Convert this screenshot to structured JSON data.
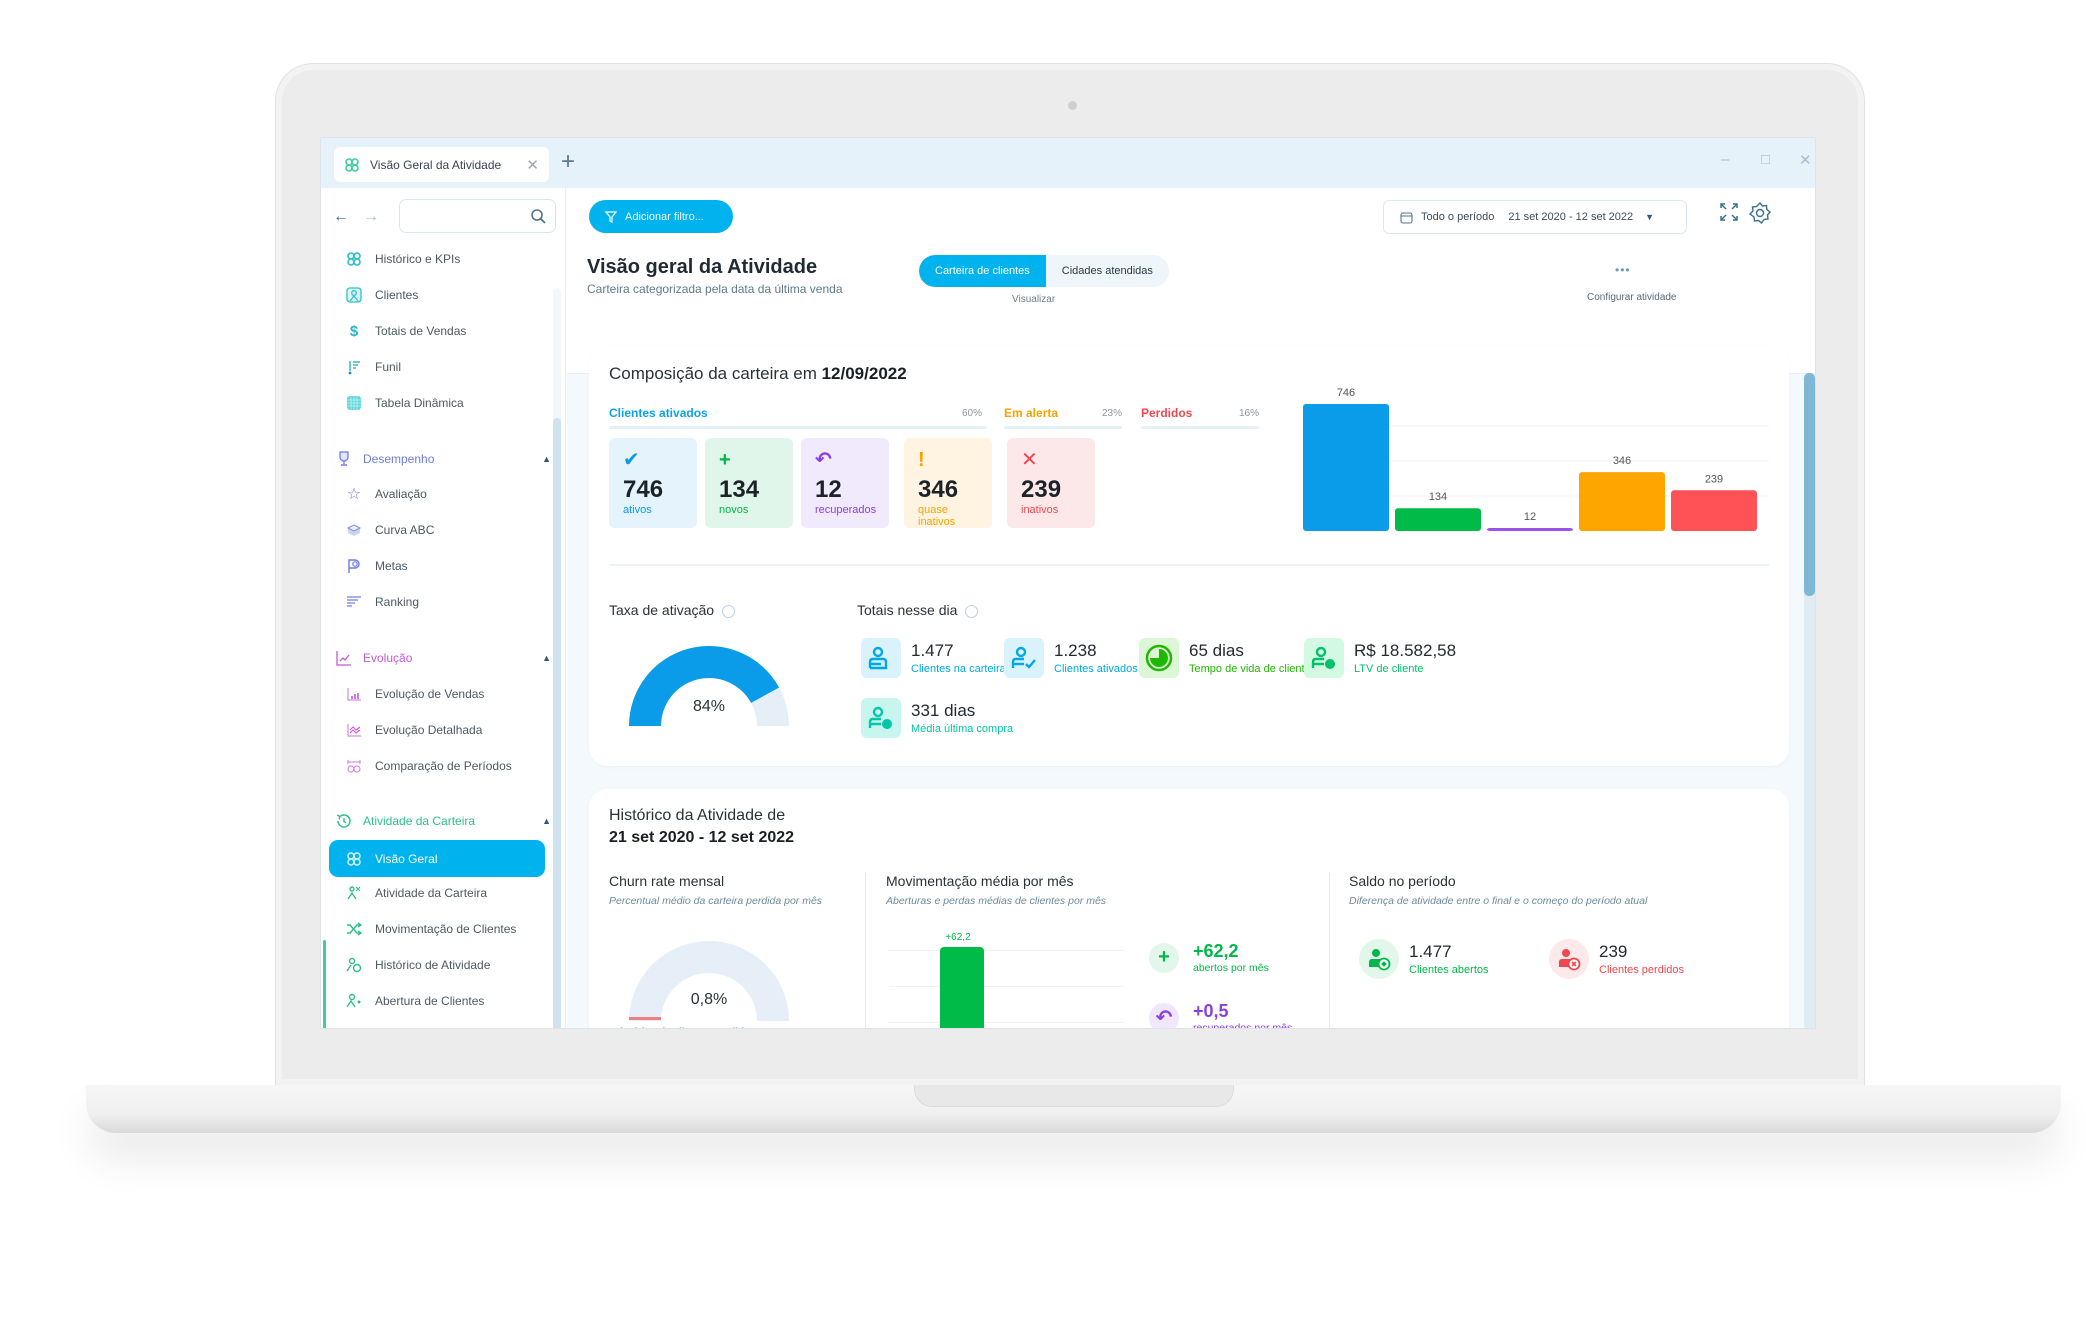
{
  "window": {
    "tab_label": "Visão Geral da Atividade",
    "new_tab": "+",
    "minimize": "–",
    "maximize": "□",
    "close": "✕"
  },
  "sidebar": {
    "back": "←",
    "forward": "→",
    "search_placeholder": "",
    "top_items": [
      {
        "label": "Histórico e KPIs",
        "icon": "kpi-grid-icon"
      },
      {
        "label": "Clientes",
        "icon": "clients-icon"
      },
      {
        "label": "Totais de Vendas",
        "icon": "dollar-icon"
      },
      {
        "label": "Funil",
        "icon": "funnel-icon"
      },
      {
        "label": "Tabela Dinâmica",
        "icon": "table-icon"
      }
    ],
    "groups": [
      {
        "label": "Desempenho",
        "icon": "trophy-icon",
        "color": "#6b7de0",
        "items": [
          {
            "label": "Avaliação",
            "icon": "star-icon"
          },
          {
            "label": "Curva ABC",
            "icon": "layers-icon"
          },
          {
            "label": "Metas",
            "icon": "flag-icon"
          },
          {
            "label": "Ranking",
            "icon": "ranking-icon"
          }
        ]
      },
      {
        "label": "Evolução",
        "icon": "trend-icon",
        "color": "#c25ad8",
        "items": [
          {
            "label": "Evolução de Vendas",
            "icon": "bar-chart-icon"
          },
          {
            "label": "Evolução Detalhada",
            "icon": "line-chart-icon"
          },
          {
            "label": "Comparação de Períodos",
            "icon": "compare-icon"
          }
        ]
      },
      {
        "label": "Atividade da Carteira",
        "icon": "history-icon",
        "color": "#2cc08a",
        "items": [
          {
            "label": "Visão Geral",
            "icon": "kpi-grid-icon",
            "active": true
          },
          {
            "label": "Atividade da Carteira",
            "icon": "users-activity-icon"
          },
          {
            "label": "Movimentação de Clientes",
            "icon": "shuffle-icon"
          },
          {
            "label": "Histórico de Atividade",
            "icon": "user-clock-icon"
          },
          {
            "label": "Abertura de Clientes",
            "icon": "user-add-icon"
          }
        ]
      }
    ]
  },
  "toolbar": {
    "filter_label": "Adicionar filtro...",
    "date_label": "Todo o período",
    "date_range": "21 set 2020 - 12 set 2022",
    "configure_label": "Configurar atividade",
    "more": "•••"
  },
  "header": {
    "title": "Visão geral da Atividade",
    "subtitle": "Carteira categorizada pela data da última venda",
    "view_tabs": [
      "Carteira de clientes",
      "Cidades atendidas"
    ],
    "view_caption": "Visualizar"
  },
  "composition": {
    "title_prefix": "Composição da carteira em ",
    "title_date": "12/09/2022",
    "categories": [
      {
        "label": "Clientes ativados",
        "pct": "60%",
        "color": "#0aa2ec"
      },
      {
        "label": "Em alerta",
        "pct": "23%",
        "color": "#f5a300"
      },
      {
        "label": "Perdidos",
        "pct": "16%",
        "color": "#f0474f"
      }
    ],
    "kpis": [
      {
        "symbol": "✔",
        "value": "746",
        "caption": "ativos",
        "color": "#0a9ae6",
        "bg": "#e4f3fc"
      },
      {
        "symbol": "+",
        "value": "134",
        "caption": "novos",
        "color": "#00b84a",
        "bg": "#e0f6ea"
      },
      {
        "symbol": "↶",
        "value": "12",
        "caption": "recuperados",
        "color": "#8a3fe0",
        "bg": "#f1e9fc"
      },
      {
        "symbol": "!",
        "value": "346",
        "caption": "quase inativos",
        "color": "#f5a300",
        "bg": "#fff4e2"
      },
      {
        "symbol": "✕",
        "value": "239",
        "caption": "inativos",
        "color": "#f0474f",
        "bg": "#fde8e9"
      }
    ]
  },
  "chart_data": {
    "type": "bar",
    "title": "",
    "categories": [
      "ativos",
      "novos",
      "recuperados",
      "quase inativos",
      "inativos"
    ],
    "values": [
      746,
      134,
      12,
      346,
      239
    ],
    "colors": [
      "#0a9ce8",
      "#00bb48",
      "#9b52e6",
      "#ffa500",
      "#ff5257"
    ],
    "xlabel": "",
    "ylabel": "",
    "ylim": [
      0,
      746
    ],
    "grid": true,
    "legend": "none"
  },
  "activation": {
    "title": "Taxa de ativação",
    "value": "84%",
    "fraction": 0.84
  },
  "totals": {
    "title": "Totais nesse dia",
    "stats": [
      {
        "value": "1.477",
        "caption": "Clientes na carteira",
        "icon": "user-icon",
        "color": "#00a8e8",
        "bg": "#d9f2fc"
      },
      {
        "value": "1.238",
        "caption": "Clientes ativados",
        "icon": "user-check-icon",
        "color": "#00a8e8",
        "bg": "#d9f2fc"
      },
      {
        "value": "65 dias",
        "caption": "Tempo de vida de cliente",
        "icon": "clock-pie-icon",
        "color": "#1fb800",
        "bg": "#dbf7d6"
      },
      {
        "value": "R$ 18.582,58",
        "caption": "LTV de cliente",
        "icon": "user-money-icon",
        "color": "#00c26a",
        "bg": "#d4f9e2"
      },
      {
        "value": "331 dias",
        "caption": "Média última compra",
        "icon": "user-time-icon",
        "color": "#00c7a8",
        "bg": "#c9f5ef"
      }
    ]
  },
  "history": {
    "title_line1": "Histórico da Atividade de",
    "title_line2": "21 set 2020 - 12 set 2022",
    "churn": {
      "title": "Churn rate mensal",
      "caption": "Percentual médio da carteira perdida por mês",
      "value": "0,8%",
      "fraction": 0.008,
      "link": "Histórico de clientes perdidos ›"
    },
    "movement": {
      "title": "Movimentação média por mês",
      "caption": "Aberturas e perdas médias de clientes por mês",
      "bar_label": "+62,2",
      "items": [
        {
          "value": "+62,2",
          "caption": "abertos por mês",
          "symbol": "+",
          "color": "#00b84a",
          "bg": "#e2f7ea"
        },
        {
          "value": "+0,5",
          "caption": "recuperados por mês",
          "symbol": "↶",
          "color": "#8a3fe0",
          "bg": "#f0e7fc"
        }
      ]
    },
    "balance": {
      "title": "Saldo no período",
      "caption": "Diferença de atividade entre o final e o começo do período atual",
      "items": [
        {
          "value": "1.477",
          "caption": "Clientes abertos",
          "color": "#00b84a",
          "bg": "#e2f7ea"
        },
        {
          "value": "239",
          "caption": "Clientes perdidos",
          "color": "#f0474f",
          "bg": "#fde9ea"
        }
      ]
    }
  }
}
